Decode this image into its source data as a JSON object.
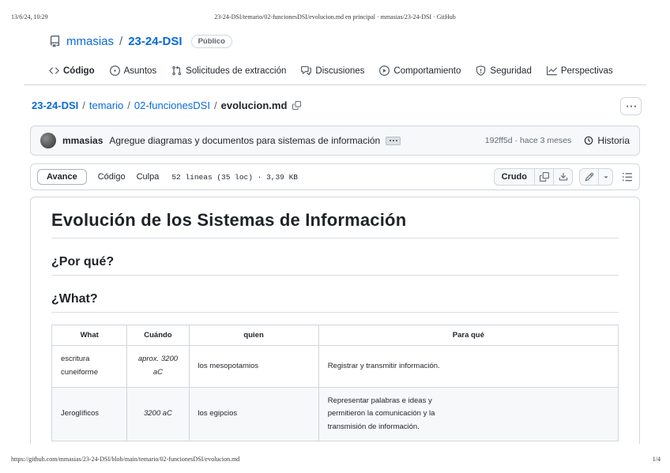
{
  "print": {
    "datetime": "13/6/24, 10:29",
    "doc_title": "23-24-DSI/temario/02-funcionesDSI/evolucion.md en principal · mmasias/23-24-DSI · GitHub",
    "url": "https://github.com/mmasias/23-24-DSI/blob/main/temario/02-funcionesDSI/evolucion.md",
    "page_number": "1/4"
  },
  "repo_header": {
    "owner": "mmasias",
    "sep": "/",
    "name": "23-24-DSI",
    "visibility_badge": "Público"
  },
  "nav": {
    "items": [
      {
        "label": "Código",
        "icon": "code-icon"
      },
      {
        "label": "Asuntos",
        "icon": "issue-icon"
      },
      {
        "label": "Solicitudes de extracción",
        "icon": "pull-request-icon"
      },
      {
        "label": "Discusiones",
        "icon": "discussions-icon"
      },
      {
        "label": "Comportamiento",
        "icon": "play-icon"
      },
      {
        "label": "Seguridad",
        "icon": "shield-icon"
      },
      {
        "label": "Perspectivas",
        "icon": "graph-icon"
      }
    ]
  },
  "breadcrumb": {
    "repo": "23-24-DSI",
    "sep": "/",
    "dir1": "temario",
    "dir2": "02-funcionesDSI",
    "file": "evolucion.md"
  },
  "commit_bar": {
    "author": "mmasias",
    "message": "Agregue diagramas y documentos para sistemas de información",
    "sha_and_age": "192ff5d · hace 3 meses",
    "history_label": "Historia"
  },
  "file_toolbar": {
    "preview_tab": "Avance",
    "code_tab": "Código",
    "blame_tab": "Culpa",
    "file_info": "52 líneas (35 loc) · 3,39 KB",
    "raw_button": "Crudo"
  },
  "markdown": {
    "h1": "Evolución de los Sistemas de Información",
    "h2_why": "¿Por qué?",
    "h2_what": "¿What?",
    "table": {
      "headers": [
        "What",
        "Cuándo",
        "quien",
        "Para qué"
      ],
      "rows": [
        [
          "escritura cuneiforme",
          "aprox. 3200 aC",
          "los mesopotamios",
          "Registrar y transmitir información."
        ],
        [
          "Jeroglíficos",
          "3200 aC",
          "los egipcios",
          [
            "Representar palabras e ideas y",
            "permitieron la comunicación y la",
            "transmisión de información."
          ]
        ]
      ]
    }
  },
  "colors": {
    "link_blue": "#0969da",
    "border_gray": "#d0d7de",
    "text": "#1f2328",
    "muted": "#59636e"
  }
}
